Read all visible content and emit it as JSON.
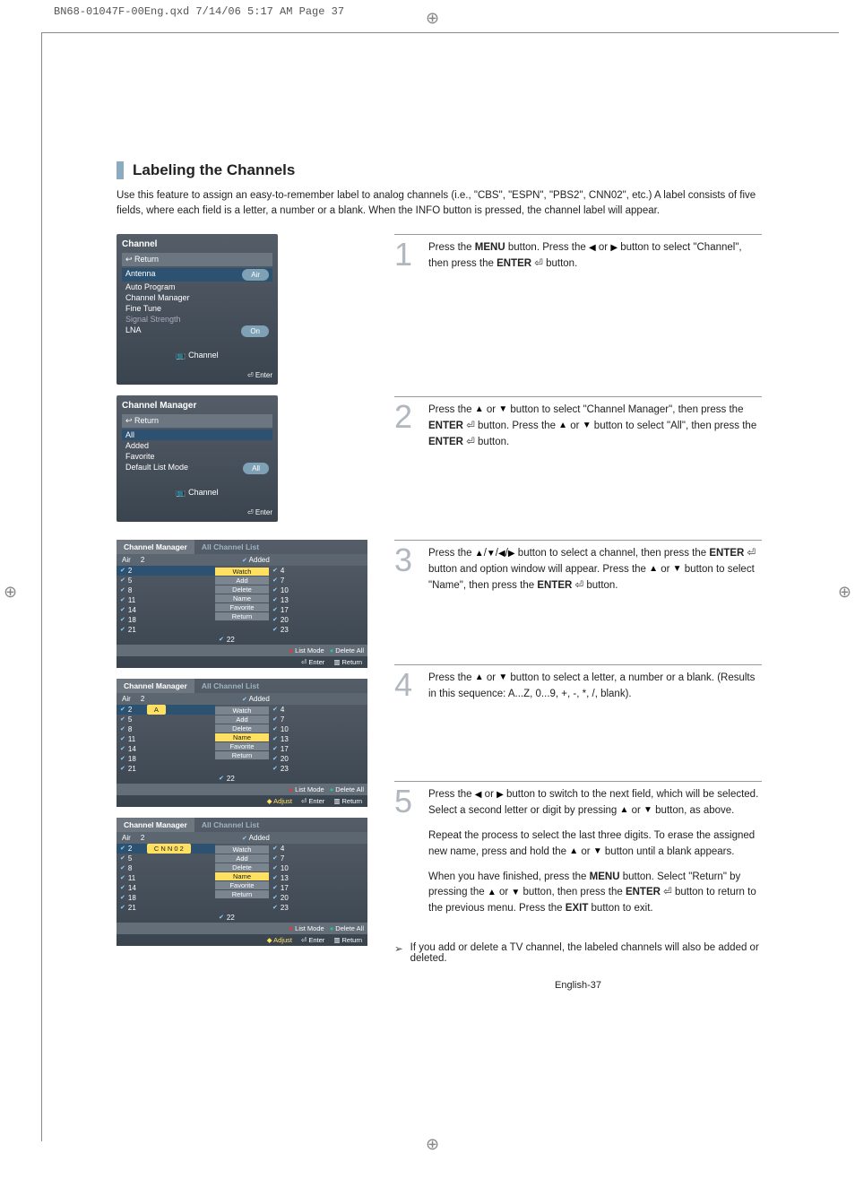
{
  "slug": "BN68-01047F-00Eng.qxd  7/14/06  5:17 AM  Page 37",
  "section_title": "Labeling the Channels",
  "intro": "Use this feature to assign an easy-to-remember label to analog channels (i.e., \"CBS\", \"ESPN\", \"PBS2\", CNN02\", etc.) A label consists of five fields, where each field is a letter, a number or a blank. When the INFO button is pressed, the channel label will appear.",
  "steps": {
    "s1": {
      "num": "1",
      "p1a": "Press the ",
      "p1b": "MENU",
      "p1c": " button. Press the ",
      "p1d": " or ",
      "p1e": " button to select \"Channel\", then press the ",
      "p1f": "ENTER",
      "p1g": " button."
    },
    "s2": {
      "num": "2",
      "p1a": "Press the ",
      "p1b": " or ",
      "p1c": " button to select \"Channel Manager\", then press the ",
      "p1d": "ENTER",
      "p1e": " button. Press the ",
      "p1f": " or ",
      "p1g": " button to select \"All\", then press the ",
      "p1h": "ENTER",
      "p1i": " button."
    },
    "s3": {
      "num": "3",
      "p1a": "Press the ",
      "p1b": " button to select a channel, then press the ",
      "p1c": "ENTER",
      "p1d": " button and option window will appear. Press the ",
      "p1e": " or ",
      "p1f": " button to select \"Name\", then press the ",
      "p1g": "ENTER",
      "p1h": " button."
    },
    "s4": {
      "num": "4",
      "p1a": "Press the ",
      "p1b": " or ",
      "p1c": " button to select a letter, a number or a blank. (Results in this sequence: A...Z, 0...9, +, -, *, /, blank)."
    },
    "s5": {
      "num": "5",
      "p1a": "Press the ",
      "p1b": " or ",
      "p1c": " button to switch to the next field, which will be selected. Select a second letter or digit by pressing ",
      "p1d": " or ",
      "p1e": " button, as above.",
      "p2a": "Repeat the process to select the last three digits. To erase the assigned new name, press and hold the ",
      "p2b": " or ",
      "p2c": " button until a blank appears.",
      "p3a": "When you have finished, press the ",
      "p3b": "MENU",
      "p3c": " button. Select \"Return\" by pressing the ",
      "p3d": " or ",
      "p3e": " button, then press the ",
      "p3f": "ENTER",
      "p3g": " button to return to the previous menu. Press the ",
      "p3h": "EXIT",
      "p3i": " button to exit."
    }
  },
  "note": {
    "bullet": "➢",
    "text": "If you add or delete a TV channel, the labeled channels will also be added or deleted."
  },
  "page_number": "English-37",
  "osd1": {
    "title": "Channel",
    "return": "Return",
    "rows": {
      "antenna": "Antenna",
      "antenna_val": "Air",
      "auto": "Auto Program",
      "cm": "Channel Manager",
      "ft": "Fine Tune",
      "ss": "Signal Strength",
      "lna": "LNA",
      "lna_val": "On"
    },
    "band": "Channel",
    "footer": "Enter"
  },
  "osd2": {
    "title": "Channel Manager",
    "return": "Return",
    "rows": {
      "all": "All",
      "added": "Added",
      "fav": "Favorite",
      "dlm": "Default List Mode",
      "dlm_val": "All"
    },
    "band": "Channel",
    "footer": "Enter"
  },
  "grid_common": {
    "tab_a": "Channel Manager",
    "tab_b": "All Channel List",
    "hdr_air": "Air",
    "hdr_num": "2",
    "hdr_added": "Added",
    "left_nums": [
      "2",
      "5",
      "8",
      "11",
      "14",
      "18",
      "21"
    ],
    "right_nums": [
      "4",
      "7",
      "10",
      "13",
      "17",
      "20",
      "23"
    ],
    "right_last": "22",
    "opts": [
      "Watch",
      "Add",
      "Delete",
      "Name",
      "Favorite",
      "Return"
    ],
    "f_listmode": "List Mode",
    "f_deleteall": "Delete All",
    "f_enter": "Enter",
    "f_return": "Return",
    "f_adjust": "Adjust"
  },
  "grid3": {
    "sel_label": ""
  },
  "grid4": {
    "sel_label": "A"
  },
  "grid5": {
    "sel_label": "C N N 0 2"
  }
}
